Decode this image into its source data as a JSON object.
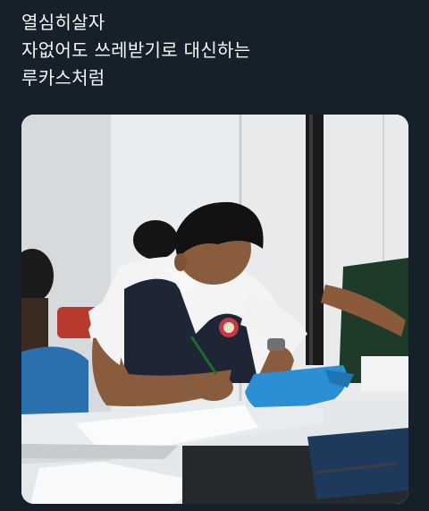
{
  "tweet": {
    "lines": [
      "열심히살자",
      "자없어도 쓰레받기로 대신하는",
      "루카스처럼"
    ]
  },
  "photo": {
    "description_icon": "photo-icon",
    "colors": {
      "background": "#15202b",
      "wall": "#e4e8ea",
      "vest": "#1e2535",
      "dustpan": "#2b8fd6",
      "desk": "#eceff1",
      "chair": "#2a6fae"
    }
  }
}
